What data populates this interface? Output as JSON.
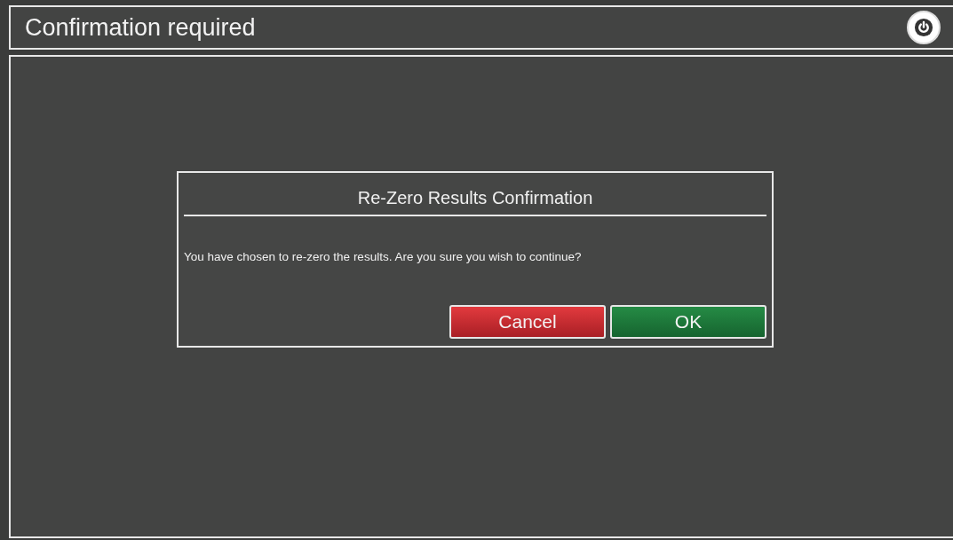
{
  "header": {
    "title": "Confirmation required"
  },
  "dialog": {
    "title": "Re-Zero Results Confirmation",
    "message": "You have chosen to re-zero the results. Are you sure you wish to continue?",
    "buttons": [
      {
        "label": "Cancel",
        "kind": "cancel"
      },
      {
        "label": "OK",
        "kind": "ok"
      }
    ]
  }
}
